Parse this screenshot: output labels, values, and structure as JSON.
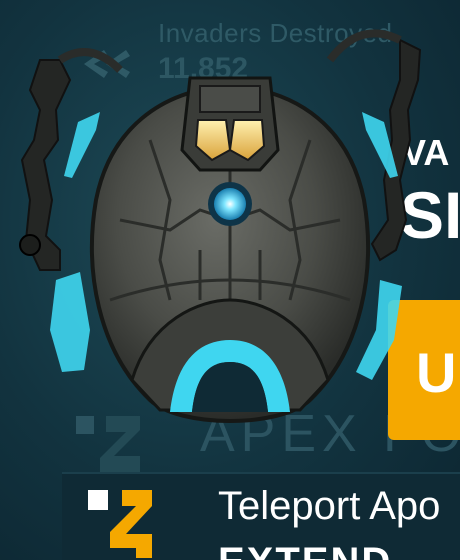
{
  "stats": {
    "label": "Invaders Destroyed",
    "value": "11,852"
  },
  "ship": {
    "variant_label": "VA",
    "name": "SI",
    "upgrade_label": "U"
  },
  "ability": {
    "title_faded": "APEX FO",
    "name": "Teleport Apo",
    "subtitle": "EXTEND"
  },
  "colors": {
    "accent_cyan": "#3fd6f0",
    "upgrade_orange": "#f5a800",
    "background": "#12333f"
  },
  "icons": [
    "back-arrows-icon",
    "teleport-ability-icon"
  ]
}
